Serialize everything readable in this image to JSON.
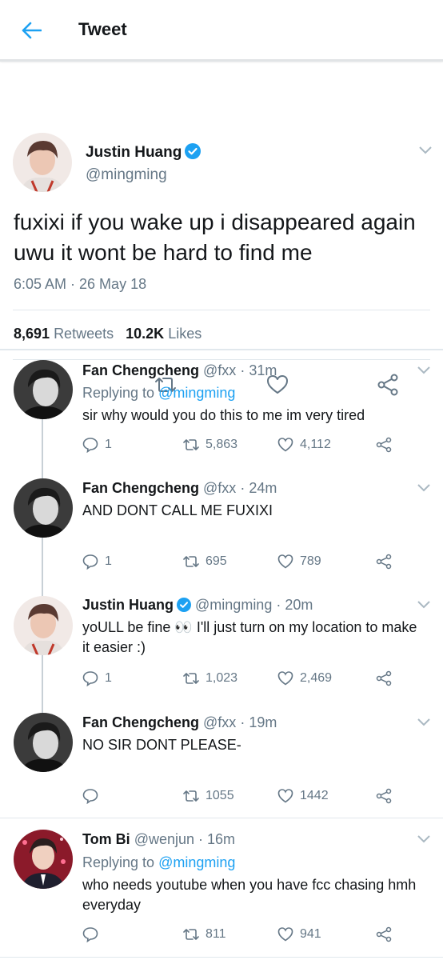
{
  "header": {
    "title": "Tweet"
  },
  "main_tweet": {
    "name": "Justin Huang",
    "handle": "@mingming",
    "text": "fuxixi if you wake up i disappeared again uwu it wont be hard to find me",
    "time": "6:05 AM · 26 May 18",
    "retweets_count": "8,691",
    "retweets_label": "Retweets",
    "likes_count": "10.2K",
    "likes_label": "Likes"
  },
  "replies": [
    {
      "name": "Fan Chengcheng",
      "handle": "@fxx",
      "time": "· 31m",
      "replying_prefix": "Replying to",
      "replying_to": "@mingming",
      "text": "sir why would you do this to me im very tired",
      "replies": "1",
      "retweets": "5,863",
      "likes": "4,112"
    },
    {
      "name": "Fan Chengcheng",
      "handle": "@fxx",
      "time": "· 24m",
      "text": "AND DONT CALL ME FUXIXI",
      "replies": "1",
      "retweets": "695",
      "likes": "789"
    },
    {
      "name": "Justin Huang",
      "handle": "@mingming",
      "time": "· 20m",
      "text": "yoULL be fine 👀 I'll just turn on my location to make it easier :)",
      "replies": "1",
      "retweets": "1,023",
      "likes": "2,469"
    },
    {
      "name": "Fan Chengcheng",
      "handle": "@fxx",
      "time": "· 19m",
      "text": "NO SIR DONT PLEASE-",
      "replies": "",
      "retweets": "1055",
      "likes": "1442"
    },
    {
      "name": "Tom Bi",
      "handle": "@wenjun",
      "time": "· 16m",
      "replying_prefix": "Replying to",
      "replying_to": "@mingming",
      "text": "who needs youtube when you have fcc chasing hmh everyday",
      "replies": "",
      "retweets": "811",
      "likes": "941"
    }
  ],
  "colors": {
    "accent": "#1da1f2",
    "secondary_text": "#657786",
    "divider": "#e1e8ed"
  }
}
